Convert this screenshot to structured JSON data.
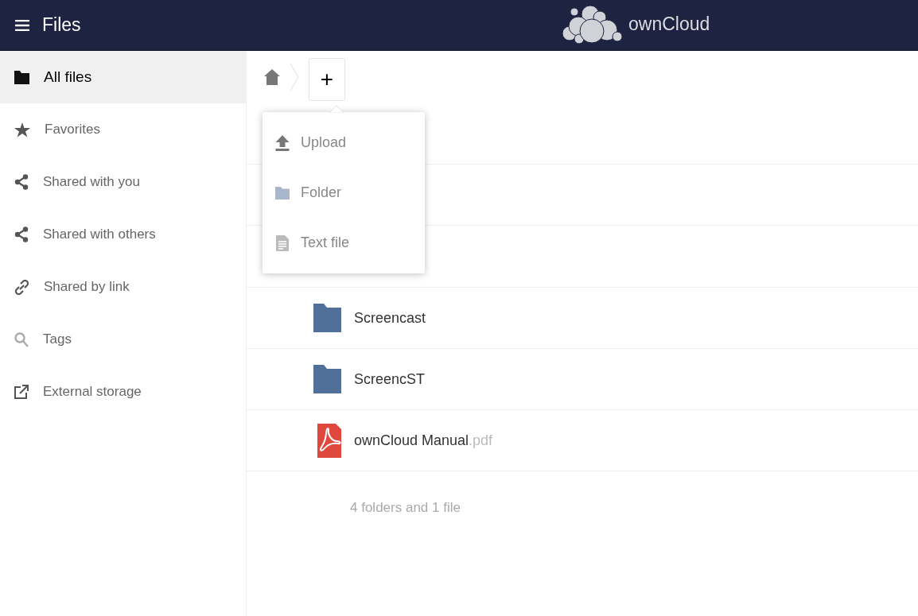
{
  "header": {
    "app_title": "Files",
    "logo_text": "ownCloud"
  },
  "sidebar": {
    "items": [
      {
        "label": "All files",
        "selected": true
      },
      {
        "label": "Favorites",
        "selected": false
      },
      {
        "label": "Shared with you",
        "selected": false
      },
      {
        "label": "Shared with others",
        "selected": false
      },
      {
        "label": "Shared by link",
        "selected": false
      },
      {
        "label": "Tags",
        "selected": false
      },
      {
        "label": "External storage",
        "selected": false
      }
    ]
  },
  "new_menu": {
    "button": "+",
    "items": [
      {
        "label": "Upload"
      },
      {
        "label": "Folder"
      },
      {
        "label": "Text file"
      }
    ]
  },
  "files": [
    {
      "kind": "folder",
      "name": "Screencast"
    },
    {
      "kind": "folder",
      "name": "ScreencST"
    },
    {
      "kind": "pdf",
      "name": "ownCloud Manual",
      "extension": ".pdf"
    }
  ],
  "summary": "4 folders and 1 file"
}
